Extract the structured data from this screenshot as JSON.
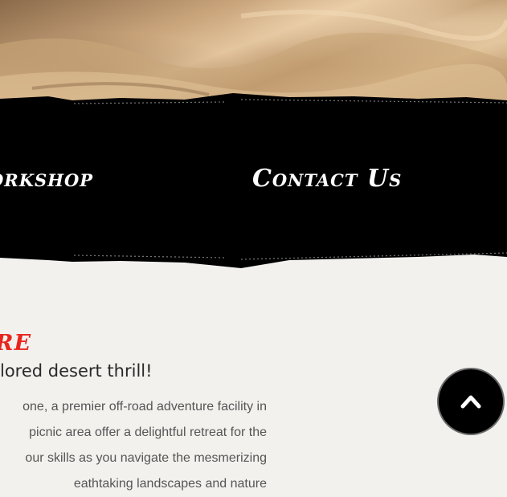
{
  "nav": {
    "items": [
      {
        "label": "orkshop"
      },
      {
        "label": "Contact Us"
      }
    ]
  },
  "intro": {
    "heading": "re",
    "subheading": "lored desert thrill!",
    "paragraph_lines": [
      "one, a premier off-road adventure facility in",
      "picnic area offer a delightful retreat for the",
      "our skills as you navigate the mesmerizing",
      "eathtaking landscapes and nature"
    ]
  },
  "scroll_top": {
    "icon": "chevron-up-icon"
  },
  "colors": {
    "accent": "#e8261e",
    "band": "#000000",
    "background": "#f2f1ee"
  }
}
